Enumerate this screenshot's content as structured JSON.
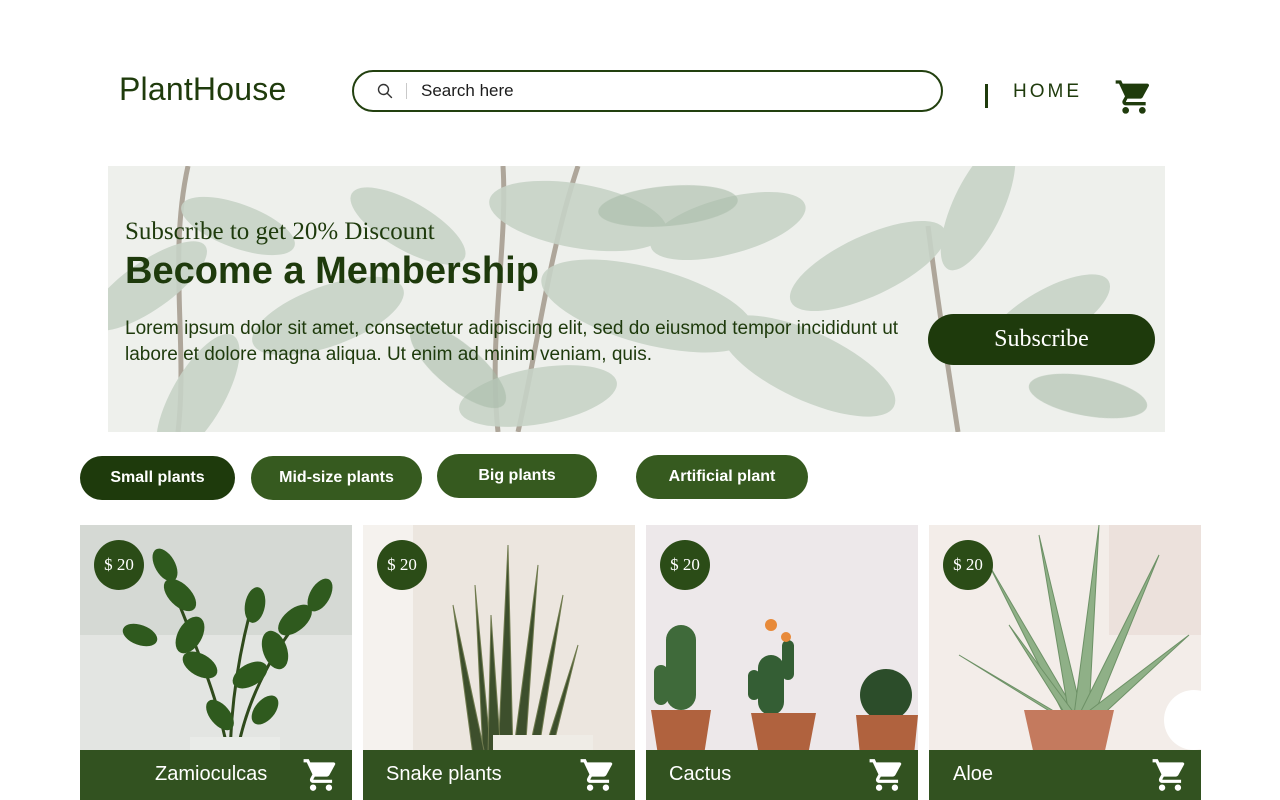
{
  "brand": {
    "name": "PlantHouse"
  },
  "search": {
    "placeholder": "Search here"
  },
  "nav": {
    "home": "HOME"
  },
  "icons": {
    "search": "search-icon",
    "cart": "cart-icon"
  },
  "banner": {
    "tag": "Subscribe to get 20% Discount",
    "headline": "Become a Membership",
    "body": "Lorem ipsum dolor sit amet, consectetur adipiscing elit, sed do eiusmod tempor incididunt ut labore et dolore magna aliqua. Ut enim ad minim veniam, quis.",
    "button": "Subscribe"
  },
  "filters": [
    {
      "label": "Small plants",
      "active": true
    },
    {
      "label": "Mid-size plants",
      "active": false
    },
    {
      "label": "Big plants",
      "active": false
    },
    {
      "label": "Artificial plant",
      "active": false
    }
  ],
  "products": [
    {
      "name": "Zamioculcas",
      "price": "$ 20"
    },
    {
      "name": "Snake plants",
      "price": "$ 20"
    },
    {
      "name": "Cactus",
      "price": "$ 20"
    },
    {
      "name": "Aloe",
      "price": "$ 20"
    }
  ],
  "colors": {
    "primary": "#1e3a0c",
    "chip": "#365a1f",
    "card_bar": "#325220",
    "banner_bg": "#eef0ec"
  }
}
